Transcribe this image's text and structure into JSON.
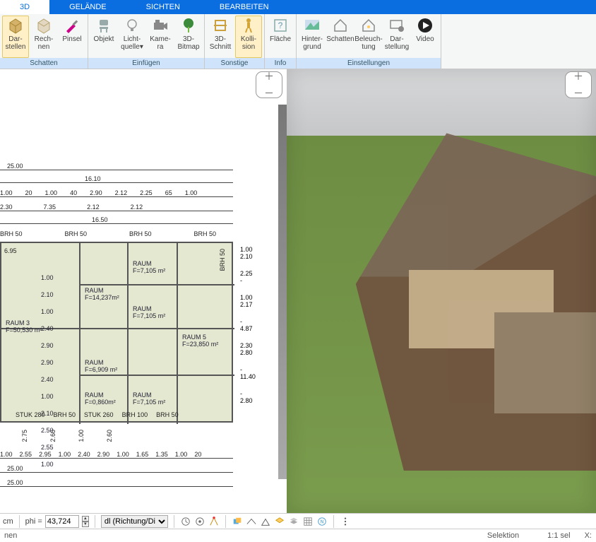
{
  "tabs": {
    "t3d": "3D",
    "gelaende": "GELÄNDE",
    "sichten": "SICHTEN",
    "bearbeiten": "BEARBEITEN"
  },
  "ribbon": {
    "schatten": {
      "title": "Schatten",
      "darstellen": "Dar-\nstellen",
      "rechnen": "Rech-\nnen",
      "pinsel": "Pinsel"
    },
    "einfuegen": {
      "title": "Einfügen",
      "objekt": "Objekt",
      "lichtquelle": "Licht-\nquelle▾",
      "kamera": "Kame-\nra",
      "bitmap3d": "3D-\nBitmap"
    },
    "sonstige": {
      "title": "Sonstige",
      "schnitt3d": "3D-\nSchnitt",
      "kollision": "Kolli-\nsion"
    },
    "info": {
      "title": "Info",
      "flaeche": "Fläche"
    },
    "einstellungen": {
      "title": "Einstellungen",
      "hintergrund": "Hinter-\ngrund",
      "schatten": "Schatten",
      "beleuchtung": "Beleuch-\ntung",
      "darstellung": "Dar-\nstellung",
      "video": "Video"
    }
  },
  "plan": {
    "dims_top_outer": [
      "25.00"
    ],
    "dims_top_2": [
      "16.10"
    ],
    "dims_top_3": [
      "1.00",
      "20",
      "1.00",
      "40",
      "2.90",
      "2.12",
      "2.25",
      "65",
      "1.00"
    ],
    "dims_top_4": [
      "2.30",
      "7.35",
      "2.12",
      "2.12"
    ],
    "dims_top_5": [
      "16.50"
    ],
    "brh_row": [
      "BRH 50",
      "BRH 50",
      "BRH 50",
      "BRH 50"
    ],
    "left_room": {
      "name": "RAUM 3",
      "area": "F=50,530 m²"
    },
    "rooms": [
      {
        "name": "RAUM",
        "area": "F=14,237m²"
      },
      {
        "name": "RAUM",
        "area": "F=7,105 m²"
      },
      {
        "name": "RAUM",
        "area": "F=7,105 m²"
      },
      {
        "name": "RAUM 5",
        "area": "F=23,850 m²"
      },
      {
        "name": "RAUM",
        "area": "F=6,909 m²"
      },
      {
        "name": "RAUM",
        "area": "F=0,860m²"
      },
      {
        "name": "RAUM",
        "area": "F=7,105 m²"
      }
    ],
    "inner_dims": [
      "1.00",
      "2.10",
      "1.00",
      "2.40",
      "2.90",
      "2.90",
      "2.40",
      "1.00",
      "2.10",
      "2.50",
      "2.55",
      "1.00"
    ],
    "right_col_pairs": [
      [
        "1.00",
        "2.10"
      ],
      [
        "2.25",
        "-"
      ],
      [
        "1.00",
        "2.17"
      ],
      [
        "-",
        "4.87"
      ],
      [
        "2.30",
        "2.80"
      ],
      [
        "-",
        "11.40"
      ],
      [
        "-",
        "2.80"
      ]
    ],
    "brh_vert": "BRH 50",
    "bottom_labels": [
      "STUK 280",
      "BRH 50",
      "STUK 260",
      "BRH 100",
      "BRH 50"
    ],
    "bottom_vpairs": [
      "2.75",
      "2.60",
      "1.00",
      "2.60"
    ],
    "dims_bottom_1": [
      "25.00"
    ],
    "dims_bottom_2": [
      "1.00",
      "2.55",
      "2.95",
      "1.00",
      "2.40",
      "2.90",
      "1.00",
      "1.65",
      "1.35",
      "1.00",
      "20"
    ],
    "dims_bottom_3": [
      "25.00"
    ]
  },
  "toolbar": {
    "cm": "cm",
    "phi_label": "phi =",
    "phi_value": "43,724",
    "dl_select": "dl (Richtung/Di"
  },
  "status": {
    "left": "nen",
    "selektion": "Selektion",
    "ratio": "1:1 sel",
    "x": "X:"
  }
}
